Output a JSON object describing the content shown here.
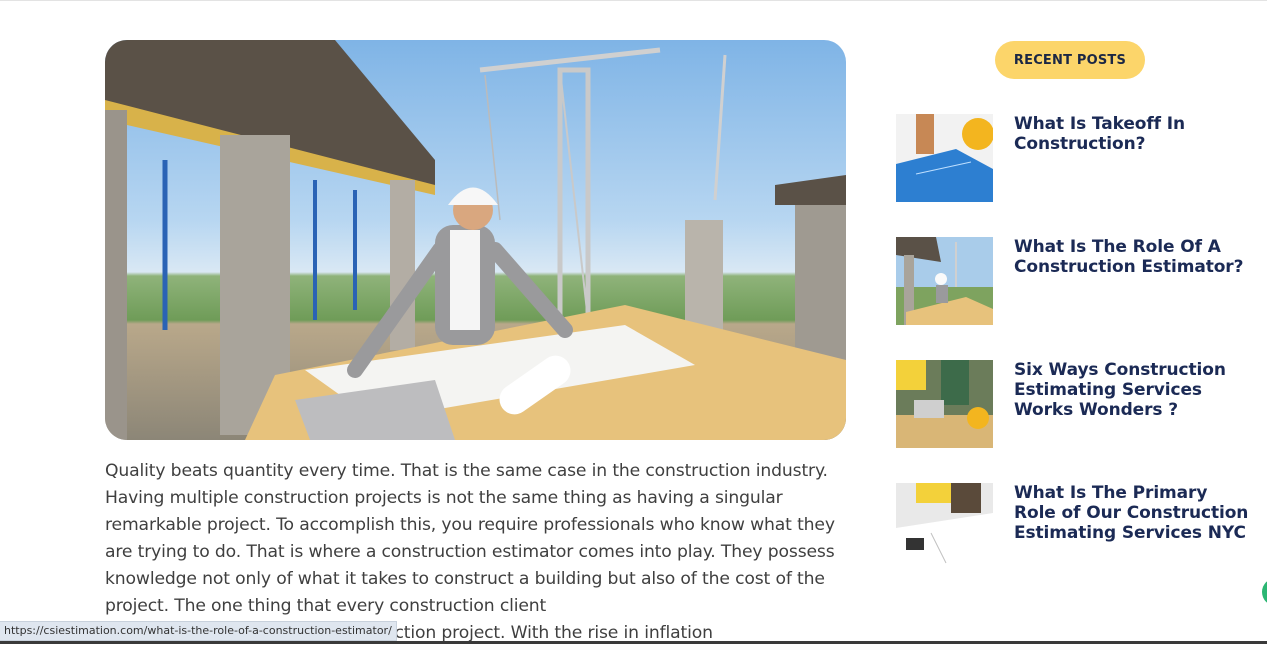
{
  "hero": {
    "alt_icon": "construction-site-photo"
  },
  "article": {
    "paragraph": "Quality beats quantity every time. That is the same case in the construction industry. Having multiple construction projects is not the same thing as having a singular remarkable project. To accomplish this, you require professionals who know what they are trying to do. That is where a construction estimator comes into play. They possess knowledge not only of what it takes to construct a building but also of the cost of the project. The one thing that every construction client",
    "last_line_visible": "heir construction project. With the rise in inflation"
  },
  "sidebar": {
    "heading": "RECENT POSTS",
    "posts": [
      {
        "title": "What Is Takeoff In Construction?",
        "thumb_icon": "blueprint-thumbnail"
      },
      {
        "title": "What Is The Role Of A Construction Estimator?",
        "thumb_icon": "site-engineer-thumbnail"
      },
      {
        "title": "Six Ways Construction Estimating Services Works Wonders ?",
        "thumb_icon": "team-meeting-thumbnail"
      },
      {
        "title": "What Is The Primary Role of Our Construction Estimating Services NYC",
        "thumb_icon": "plans-review-thumbnail"
      }
    ]
  },
  "status_bar": {
    "url": "https://csiestimation.com/what-is-the-role-of-a-construction-estimator/"
  },
  "colors": {
    "badge": "#fcd56a",
    "title": "#1b2a55",
    "body_text": "#3f3f3f"
  }
}
